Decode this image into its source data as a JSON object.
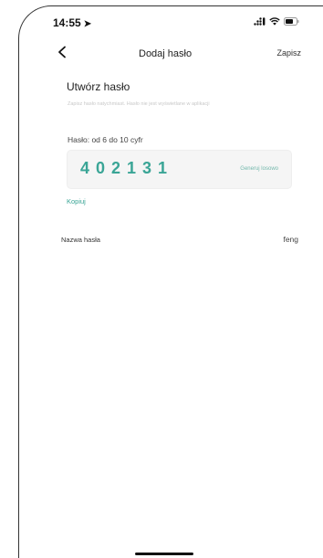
{
  "status_bar": {
    "time": "14:55"
  },
  "nav": {
    "title": "Dodaj hasło",
    "save_label": "Zapisz",
    "back_icon": "chevron-left-icon"
  },
  "create": {
    "title": "Utwórz hasło",
    "hint": "Zapisz hasło natychmiast. Hasło nie jest wyświetlane w aplikacji"
  },
  "password": {
    "label": "Hasło: od 6 do 10 cyfr",
    "value": "402131",
    "generate_label": "Generuj losowo",
    "copy_label": "Kopiuj",
    "accent_color": "#3aa596"
  },
  "name": {
    "label": "Nazwa hasła",
    "value": "feng"
  }
}
